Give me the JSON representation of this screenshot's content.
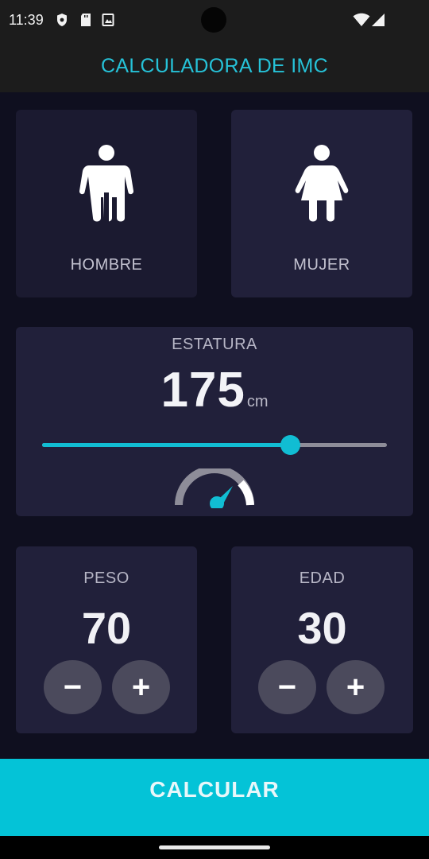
{
  "status_bar": {
    "time": "11:39",
    "left_icons": [
      "shield-icon",
      "sd-card-icon",
      "image-icon"
    ],
    "right_icons": [
      "wifi-icon",
      "signal-icon"
    ]
  },
  "app_bar": {
    "title": "CALCULADORA DE IMC",
    "title_color": "#26c2d8"
  },
  "gender": {
    "male_label": "HOMBRE",
    "female_label": "MUJER",
    "male_icon": "male-person-icon",
    "female_icon": "female-person-icon"
  },
  "height_card": {
    "label": "ESTATURA",
    "value": "175",
    "unit": "cm",
    "slider_fraction": 0.72,
    "gauge_icon": "speedometer-icon"
  },
  "weight_card": {
    "label": "PESO",
    "value": "70",
    "minus_label": "−",
    "plus_label": "+"
  },
  "age_card": {
    "label": "EDAD",
    "value": "30",
    "minus_label": "−",
    "plus_label": "+"
  },
  "calculate_button": {
    "label": "CALCULAR",
    "color": "#04c3d7"
  },
  "colors": {
    "accent": "#11bdd3",
    "card": "#21203a",
    "background": "#0f0f1f",
    "button": "#4b4a5c"
  }
}
